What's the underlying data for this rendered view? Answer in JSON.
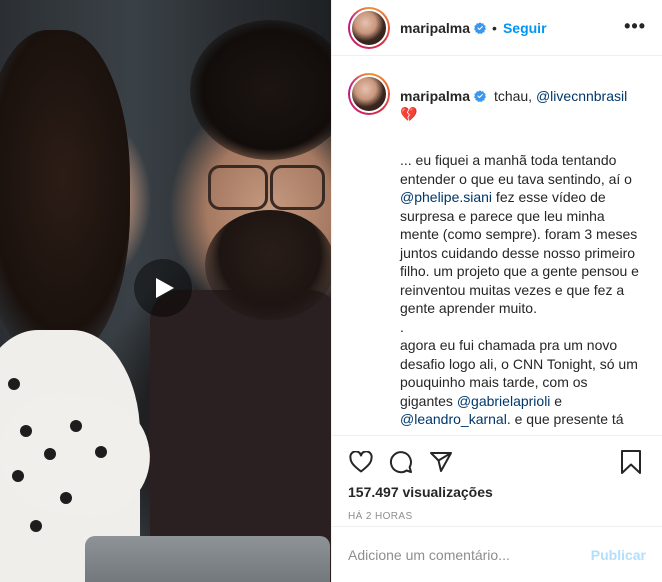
{
  "media": {
    "type": "video",
    "play_icon": "play-icon"
  },
  "header": {
    "username": "maripalma",
    "verified_icon": "verified-badge-icon",
    "separator": "•",
    "follow_label": "Seguir",
    "more_label": "•••"
  },
  "caption": {
    "username": "maripalma",
    "first_line_prefix": "tchau, ",
    "first_line_mention": "@livecnnbrasil",
    "emoji": "💔",
    "paragraph1_a": "... eu fiquei a manhã toda tentando entender o que eu tava sentindo, aí o ",
    "mention_phelipe": "@phelipe.siani",
    "paragraph1_b": " fez esse vídeo de surpresa e parece que leu minha mente (como sempre). foram 3 meses juntos cuidando desse nosso primeiro filho. um projeto que a gente pensou e reinventou muitas vezes e que fez a gente aprender muito.",
    "dot_line": ".",
    "paragraph2_a": "agora eu fui chamada pra um novo desafio logo ali, o CNN Tonight, só um pouquinho mais tarde, com os gigantes ",
    "mention_gabriela": "@gabrielaprioli",
    "paragraph2_b": " e ",
    "mention_leandro": "@leandro_karnal",
    "paragraph2_c": ". e que presente tá"
  },
  "actions": {
    "like_icon": "heart-icon",
    "comment_icon": "comment-icon",
    "share_icon": "share-icon",
    "save_icon": "bookmark-icon",
    "views": "157.497 visualizações",
    "time": "HÁ 2 HORAS"
  },
  "comment_box": {
    "placeholder": "Adicione um comentário...",
    "publish_label": "Publicar"
  },
  "colors": {
    "link_blue": "#0095f6",
    "mention_blue": "#00376b",
    "publish_disabled": "#b2dffc",
    "muted": "#8e8e8e",
    "text": "#262626",
    "border": "#efefef"
  }
}
